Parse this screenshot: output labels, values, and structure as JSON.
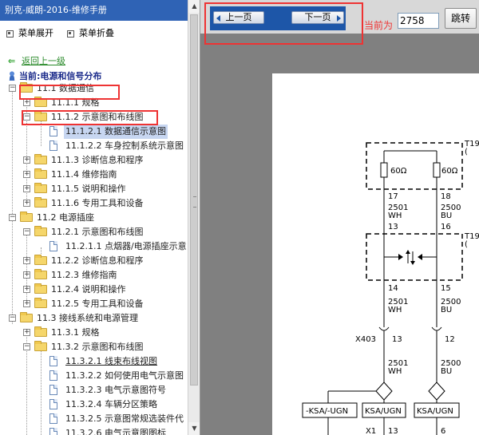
{
  "window": {
    "title": "别克-威朗-2016-维修手册"
  },
  "menu": {
    "expand_label": "菜单展开",
    "collapse_label": "菜单折叠"
  },
  "back_link": "返回上一级",
  "current_location": "当前:电源和信号分布",
  "tree": [
    {
      "label": "11.1 数据通信"
    },
    {
      "label": "11.1.1 规格"
    },
    {
      "label": "11.1.2 示意图和布线图"
    },
    {
      "label": "11.1.2.1 数据通信示意图"
    },
    {
      "label": "11.1.2.2 车身控制系统示意图"
    },
    {
      "label": "11.1.3 诊断信息和程序"
    },
    {
      "label": "11.1.4 维修指南"
    },
    {
      "label": "11.1.5 说明和操作"
    },
    {
      "label": "11.1.6 专用工具和设备"
    },
    {
      "label": "11.2 电源插座"
    },
    {
      "label": "11.2.1 示意图和布线图"
    },
    {
      "label": "11.2.1.1 点烟器/电源插座示意"
    },
    {
      "label": "11.2.2 诊断信息和程序"
    },
    {
      "label": "11.2.3 维修指南"
    },
    {
      "label": "11.2.4 说明和操作"
    },
    {
      "label": "11.2.5 专用工具和设备"
    },
    {
      "label": "11.3 接线系统和电源管理"
    },
    {
      "label": "11.3.1 规格"
    },
    {
      "label": "11.3.2 示意图和布线图"
    },
    {
      "label": "11.3.2.1 线束布线视图"
    },
    {
      "label": "11.3.2.2 如何使用电气示意图"
    },
    {
      "label": "11.3.2.3 电气示意图符号"
    },
    {
      "label": "11.3.2.4 车辆分区策略"
    },
    {
      "label": "11.3.2.5 示意图常规选装件代"
    },
    {
      "label": "11.3.2.6 电气示意图图标"
    }
  ],
  "nav": {
    "prev_label": "上一页",
    "next_label": "下一页",
    "current_page_label": "当前为",
    "page_value": "2758",
    "jump_label": "跳转"
  },
  "diagram_text": {
    "t19_top": "T19",
    "t19_top_sub": "(",
    "t19_mid": "T19",
    "t19_mid_sub": "(",
    "r_left": "60Ω",
    "r_right": "60Ω",
    "pin17": "17",
    "pin18": "18",
    "w2501_a": "2501",
    "wh_a": "WH",
    "w2500_a": "2500",
    "bu_a": "BU",
    "pin13a": "13",
    "pin16": "16",
    "pin14": "14",
    "pin15": "15",
    "w2501_b": "2501",
    "wh_b": "WH",
    "w2500_b": "2500",
    "bu_b": "BU",
    "x403": "X403",
    "pin13b": "13",
    "pin12": "12",
    "w2501_c": "2501",
    "wh_c": "WH",
    "w2500_c": "2500",
    "bu_c": "BU",
    "ksa_ugn_1": "-KSA/-UGN",
    "ksa_ugn_2": "KSA/UGN",
    "ksa_ugn_3": "KSA/UGN",
    "x1": "X1",
    "pin13c": "13",
    "pin6": "6"
  }
}
